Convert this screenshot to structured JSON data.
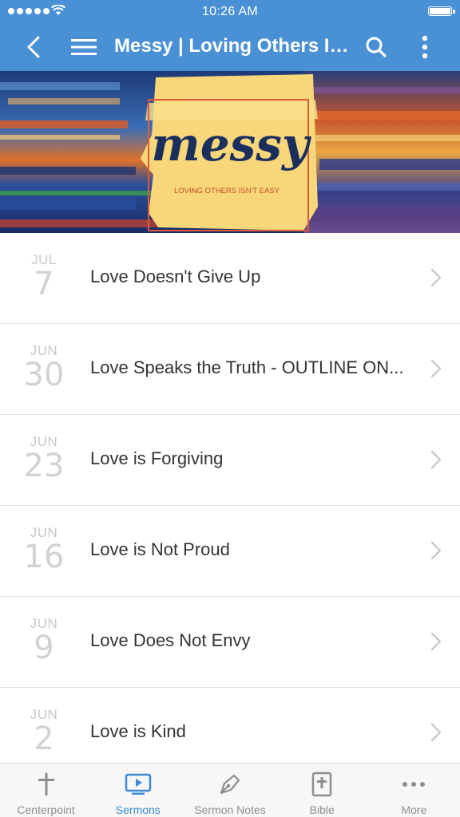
{
  "status_bar": {
    "time": "10:26 AM"
  },
  "nav": {
    "title": "Messy | Loving Others Is..."
  },
  "banner": {
    "title": "messy",
    "subtitle": "LOVING OTHERS ISN'T EASY"
  },
  "sermons": [
    {
      "month": "JUL",
      "day": "7",
      "title": "Love Doesn't Give Up"
    },
    {
      "month": "JUN",
      "day": "30",
      "title": "Love Speaks the Truth - OUTLINE ON..."
    },
    {
      "month": "JUN",
      "day": "23",
      "title": "Love is Forgiving"
    },
    {
      "month": "JUN",
      "day": "16",
      "title": "Love is Not Proud"
    },
    {
      "month": "JUN",
      "day": "9",
      "title": "Love Does Not Envy"
    },
    {
      "month": "JUN",
      "day": "2",
      "title": "Love is Kind"
    }
  ],
  "tabbar": {
    "tabs": [
      {
        "label": "Centerpoint",
        "icon": "cross-icon",
        "active": false
      },
      {
        "label": "Sermons",
        "icon": "play-screen-icon",
        "active": true
      },
      {
        "label": "Sermon Notes",
        "icon": "pen-icon",
        "active": false
      },
      {
        "label": "Bible",
        "icon": "bible-icon",
        "active": false
      },
      {
        "label": "More",
        "icon": "more-dots-icon",
        "active": false
      }
    ]
  },
  "colors": {
    "nav_blue": "#4a90d4",
    "active_tab": "#3b8ad3",
    "inactive_tab": "#8e8e8e",
    "date_gray": "#c9c9c9"
  }
}
